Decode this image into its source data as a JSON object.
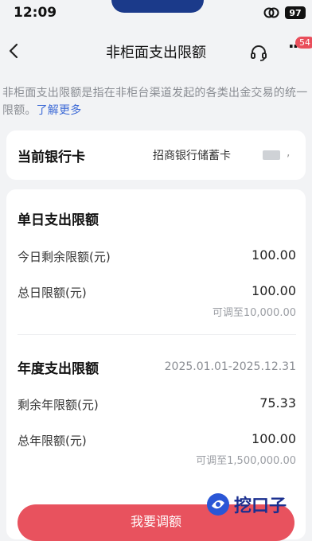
{
  "status_bar": {
    "time": "12:09",
    "battery": "97"
  },
  "nav": {
    "title": "非柜面支出限额",
    "badge": "54"
  },
  "description": {
    "text": "非柜面支出限额是指在非柜台渠道发起的各类出金交易的统一限额。",
    "link": "了解更多"
  },
  "bank_card": {
    "label": "当前银行卡",
    "value": "招商银行储蓄卡",
    "tail": ","
  },
  "daily": {
    "title": "单日支出限额",
    "remaining_label": "今日剩余限额(元)",
    "remaining_value": "100.00",
    "total_label": "总日限额(元)",
    "total_value": "100.00",
    "total_hint": "可调至10,000.00"
  },
  "yearly": {
    "title": "年度支出限额",
    "period": "2025.01.01-2025.12.31",
    "remaining_label": "剩余年限额(元)",
    "remaining_value": "75.33",
    "total_label": "总年限额(元)",
    "total_value": "100.00",
    "total_hint": "可调至1,500,000.00"
  },
  "action": {
    "adjust_label": "我要调额"
  },
  "watermark": {
    "text": "挖口子"
  }
}
